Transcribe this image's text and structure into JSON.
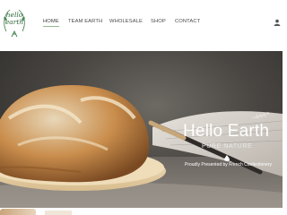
{
  "brand": {
    "line1": "hello",
    "line2": "earth"
  },
  "nav": {
    "items": [
      {
        "label": "HOME",
        "active": true
      },
      {
        "label": "TEAM EARTH",
        "active": false
      },
      {
        "label": "WHOLESALE",
        "active": false
      },
      {
        "label": "SHOP",
        "active": false
      },
      {
        "label": "CONTACT",
        "active": false
      }
    ]
  },
  "hero": {
    "title": "Hello Earth",
    "subtitle": "PURE NATURE",
    "presented": "Proudly Presented by French Confectionery"
  },
  "colors": {
    "accent_green": "#2f6a3c",
    "nav_underline": "#8fb88e",
    "hero_bg": "#4a4743"
  },
  "icons": [
    "leaf-icon",
    "user-icon",
    "drop-icon"
  ]
}
